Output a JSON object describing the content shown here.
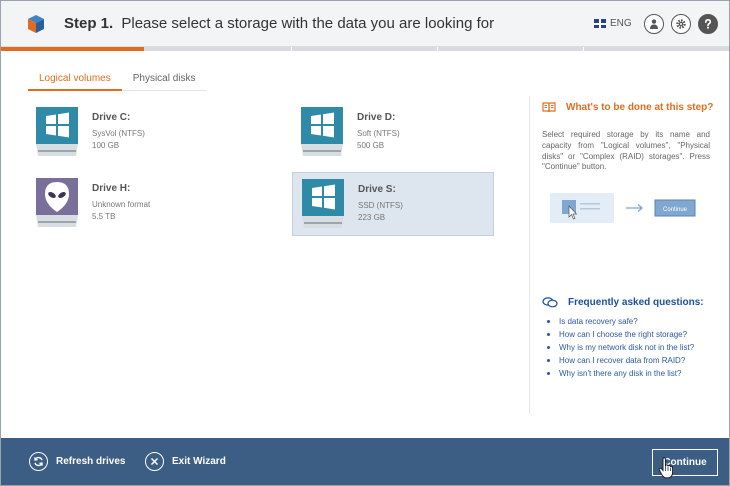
{
  "header": {
    "step_label": "Step 1.",
    "step_text": "Please select a storage with the data you are looking for",
    "language": "ENG"
  },
  "tabs": [
    {
      "label": "Logical volumes",
      "active": true
    },
    {
      "label": "Physical disks",
      "active": false
    }
  ],
  "drives": [
    {
      "name": "Drive C:",
      "filesystem": "SysVol (NTFS)",
      "size": "100 GB",
      "icon": "windows-drive-icon",
      "selected": false
    },
    {
      "name": "Drive D:",
      "filesystem": "Soft (NTFS)",
      "size": "500 GB",
      "icon": "windows-drive-icon",
      "selected": false
    },
    {
      "name": "Drive H:",
      "filesystem": "Unknown format",
      "size": "5.5 TB",
      "icon": "alien-drive-icon",
      "selected": false
    },
    {
      "name": "Drive S:",
      "filesystem": "SSD (NTFS)",
      "size": "223 GB",
      "icon": "windows-drive-icon",
      "selected": true
    }
  ],
  "help": {
    "title": "What's to be done at this step?",
    "text": "Select required storage by its name and capacity from \"Logical volumes\", \"Physical disks\" or \"Complex (RAID) storages\". Press \"Continue\" button.",
    "illustration_button": "Continue"
  },
  "faq": {
    "title": "Frequently asked questions:",
    "items": [
      "Is data recovery safe?",
      "How can I choose the right storage?",
      "Why is my network disk not in the list?",
      "How can I recover data from RAID?",
      "Why isn't there any disk in the list?"
    ]
  },
  "footer": {
    "refresh_label": "Refresh drives",
    "exit_label": "Exit Wizard",
    "continue_label": "Continue"
  },
  "colors": {
    "accent": "#e06d1f",
    "footer_bg": "#3d5e84",
    "link": "#2a5aa5",
    "drive_icon": "#2f8aa8",
    "alien_icon": "#7a6f9a"
  }
}
